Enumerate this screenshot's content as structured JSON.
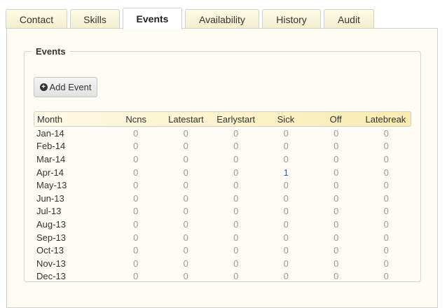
{
  "tabs": [
    {
      "label": "Contact"
    },
    {
      "label": "Skills"
    },
    {
      "label": "Events",
      "active": true
    },
    {
      "label": "Availability"
    },
    {
      "label": "History"
    },
    {
      "label": "Audit"
    }
  ],
  "events": {
    "legend": "Events",
    "add_button_label": "Add Event",
    "columns": [
      "Month",
      "Ncns",
      "Latestart",
      "Earlystart",
      "Sick",
      "Off",
      "Latebreak"
    ],
    "rows": [
      {
        "month": "Jan-14",
        "values": [
          "0",
          "0",
          "0",
          "0",
          "0",
          "0"
        ]
      },
      {
        "month": "Feb-14",
        "values": [
          "0",
          "0",
          "0",
          "0",
          "0",
          "0"
        ]
      },
      {
        "month": "Mar-14",
        "values": [
          "0",
          "0",
          "0",
          "0",
          "0",
          "0"
        ]
      },
      {
        "month": "Apr-14",
        "values": [
          "0",
          "0",
          "0",
          "1",
          "0",
          "0"
        ]
      },
      {
        "month": "May-13",
        "values": [
          "0",
          "0",
          "0",
          "0",
          "0",
          "0"
        ]
      },
      {
        "month": "Jun-13",
        "values": [
          "0",
          "0",
          "0",
          "0",
          "0",
          "0"
        ]
      },
      {
        "month": "Jul-13",
        "values": [
          "0",
          "0",
          "0",
          "0",
          "0",
          "0"
        ]
      },
      {
        "month": "Aug-13",
        "values": [
          "0",
          "0",
          "0",
          "0",
          "0",
          "0"
        ]
      },
      {
        "month": "Sep-13",
        "values": [
          "0",
          "0",
          "0",
          "0",
          "0",
          "0"
        ]
      },
      {
        "month": "Oct-13",
        "values": [
          "0",
          "0",
          "0",
          "0",
          "0",
          "0"
        ]
      },
      {
        "month": "Nov-13",
        "values": [
          "0",
          "0",
          "0",
          "0",
          "0",
          "0"
        ]
      },
      {
        "month": "Dec-13",
        "values": [
          "0",
          "0",
          "0",
          "0",
          "0",
          "0"
        ]
      }
    ]
  }
}
